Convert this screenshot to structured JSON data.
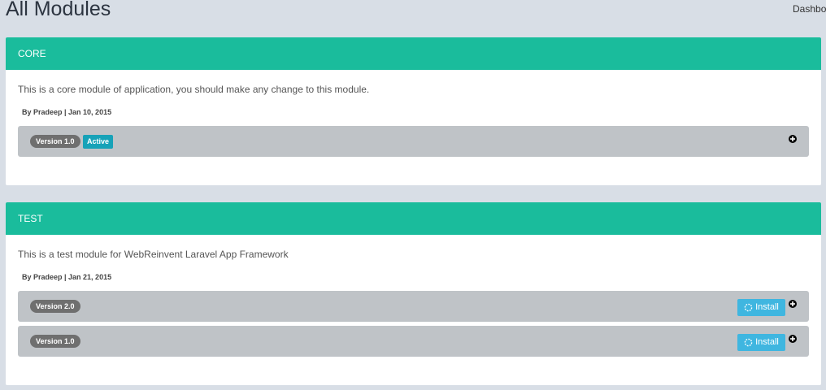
{
  "page": {
    "title": "All Modules",
    "breadcrumb": "Dashboard"
  },
  "modules": [
    {
      "name": "CORE",
      "description": "This is a core module of application, you should make any change to this module.",
      "meta": "By Pradeep  |  Jan 10, 2015",
      "versions": [
        {
          "label": "Version 1.0",
          "status": "Active"
        }
      ]
    },
    {
      "name": "TEST",
      "description": "This is a test module for WebReinvent Laravel App Framework",
      "meta": "By Pradeep  |  Jan 21, 2015",
      "versions": [
        {
          "label": "Version 2.0",
          "action": "Install"
        },
        {
          "label": "Version 1.0",
          "action": "Install"
        }
      ]
    }
  ],
  "colors": {
    "header": "#1abc9c",
    "version_row": "#bfc3c7",
    "version_badge": "#6f6f6f",
    "active_badge": "#17a2b8",
    "install_button": "#3fb6e0"
  },
  "icons": {
    "expand": "plus-circle-icon",
    "install": "spinner-icon"
  }
}
